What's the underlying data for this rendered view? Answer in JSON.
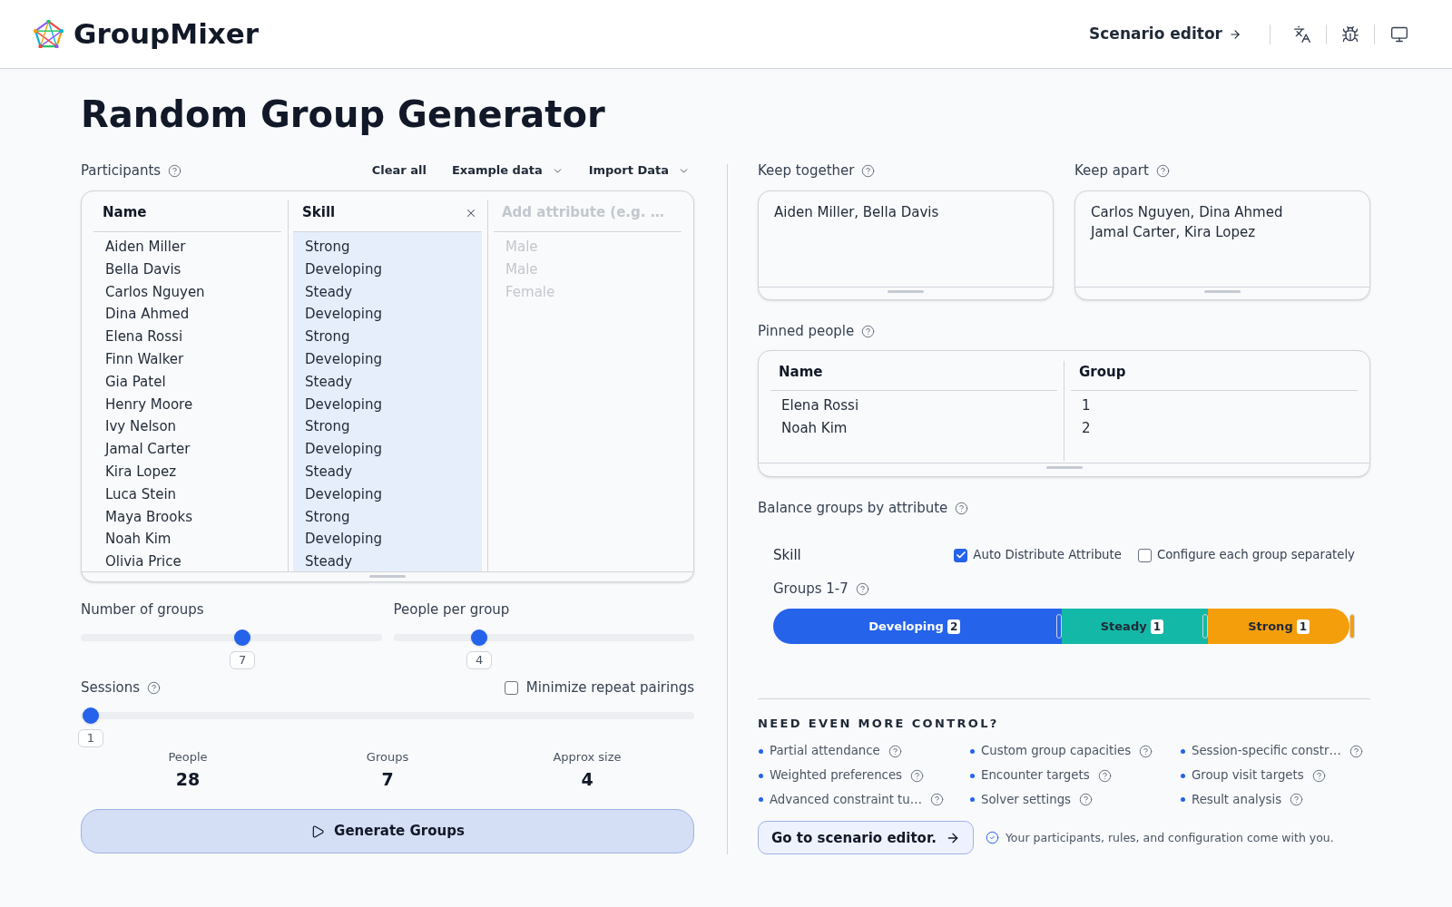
{
  "header": {
    "brand": "GroupMixer",
    "nav_link": "Scenario editor"
  },
  "title": "Random Group Generator",
  "participants": {
    "label": "Participants",
    "actions": [
      {
        "label": "Clear all",
        "kind": "button"
      },
      {
        "label": "Example data",
        "kind": "dropdown"
      },
      {
        "label": "Import Data",
        "kind": "dropdown"
      }
    ],
    "columns": [
      {
        "header": "Name",
        "removable": false,
        "selected": false
      },
      {
        "header": "Skill",
        "removable": true,
        "selected": true
      }
    ],
    "new_attribute": {
      "placeholder": "Add attribute (e.g. …",
      "cell_placeholders": [
        "Male",
        "Male",
        "Female"
      ]
    },
    "rows": [
      [
        "Aiden Miller",
        "Strong"
      ],
      [
        "Bella Davis",
        "Developing"
      ],
      [
        "Carlos Nguyen",
        "Steady"
      ],
      [
        "Dina Ahmed",
        "Developing"
      ],
      [
        "Elena Rossi",
        "Strong"
      ],
      [
        "Finn Walker",
        "Developing"
      ],
      [
        "Gia Patel",
        "Steady"
      ],
      [
        "Henry Moore",
        "Developing"
      ],
      [
        "Ivy Nelson",
        "Strong"
      ],
      [
        "Jamal Carter",
        "Developing"
      ],
      [
        "Kira Lopez",
        "Steady"
      ],
      [
        "Luca Stein",
        "Developing"
      ],
      [
        "Maya Brooks",
        "Strong"
      ],
      [
        "Noah Kim",
        "Developing"
      ],
      [
        "Olivia Price",
        "Steady"
      ]
    ]
  },
  "sliders": [
    {
      "label": "Number of groups",
      "level": 0.54,
      "value": "7"
    },
    {
      "label": "People per group",
      "level": 0.27,
      "value": "4"
    }
  ],
  "sessions": {
    "label": "Sessions",
    "level": 0,
    "value": "1",
    "option": {
      "label": "Minimize repeat pairings",
      "checked": false
    }
  },
  "stats": [
    {
      "label": "People",
      "value": "28"
    },
    {
      "label": "Groups",
      "value": "7"
    },
    {
      "label": "Approx size",
      "value": "4"
    }
  ],
  "generate_button": "Generate Groups",
  "keep_together": {
    "label": "Keep together",
    "value": "Aiden Miller, Bella Davis"
  },
  "keep_apart": {
    "label": "Keep apart",
    "value": "Carlos Nguyen, Dina Ahmed\nJamal Carter, Kira Lopez"
  },
  "pinned": {
    "label": "Pinned people",
    "columns": [
      "Name",
      "Group"
    ],
    "rows": [
      [
        "Elena Rossi",
        "1"
      ],
      [
        "Noah Kim",
        "2"
      ]
    ]
  },
  "balance": {
    "label": "Balance groups by attribute",
    "attribute": "Skill",
    "options": [
      {
        "label": "Auto Distribute Attribute",
        "checked": true
      },
      {
        "label": "Configure each group separately",
        "checked": false
      }
    ],
    "groups_label": "Groups 1-7",
    "segments": [
      {
        "label": "Developing",
        "count": "2",
        "color": "#2563eb"
      },
      {
        "label": "Steady",
        "count": "1",
        "color": "#14b8a6"
      },
      {
        "label": "Strong",
        "count": "1",
        "color": "#f59e0b"
      }
    ]
  },
  "more_control": {
    "title": "NEED EVEN MORE CONTROL?",
    "features": [
      "Partial attendance",
      "Custom group capacities",
      "Session-specific constr…",
      "Weighted preferences",
      "Encounter targets",
      "Group visit targets",
      "Advanced constraint tu…",
      "Solver settings",
      "Result analysis"
    ],
    "button": "Go to scenario editor.",
    "note": "Your participants, rules, and configuration come with you."
  }
}
